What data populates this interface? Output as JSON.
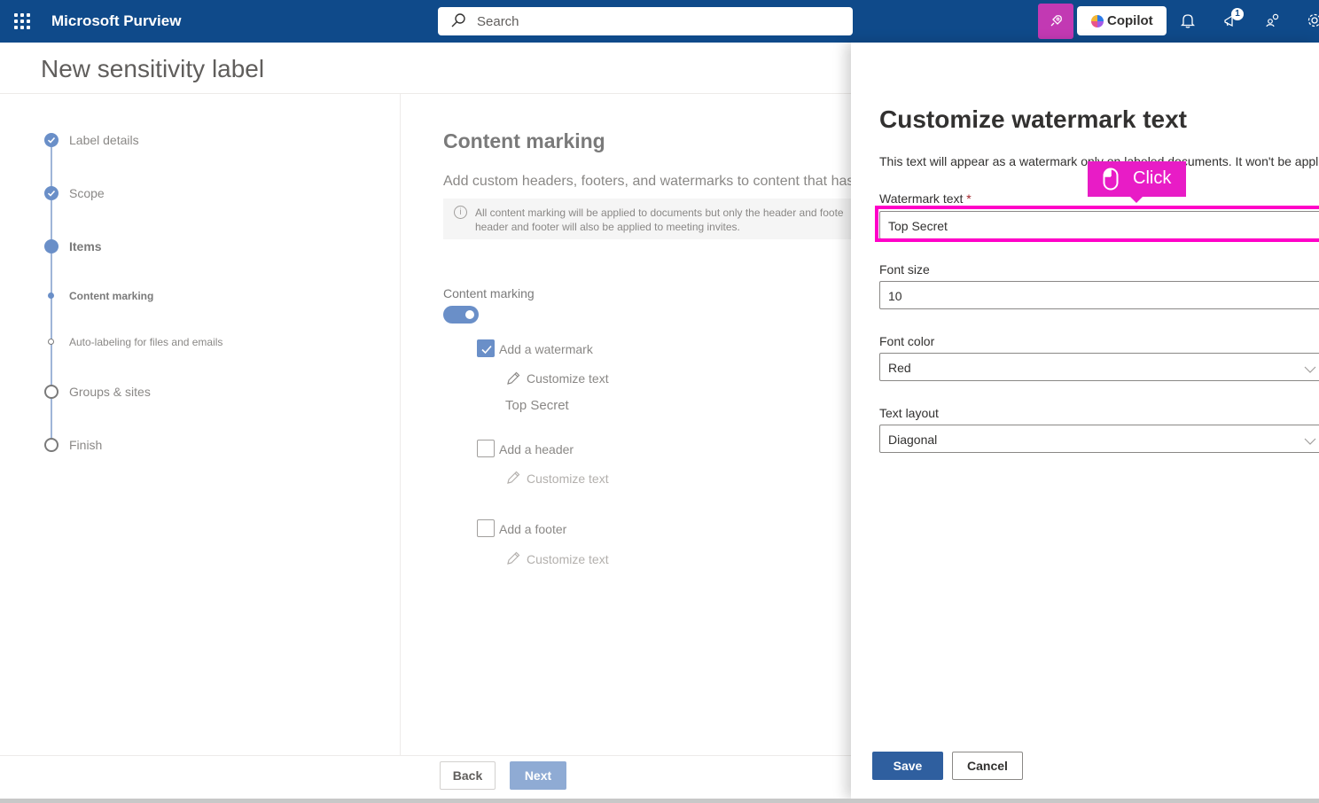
{
  "header": {
    "app_name": "Microsoft Purview",
    "search_placeholder": "Search",
    "copilot_label": "Copilot",
    "notification_count": "1"
  },
  "page": {
    "title": "New sensitivity label"
  },
  "stepper": {
    "steps": [
      {
        "label": "Label details",
        "state": "completed"
      },
      {
        "label": "Scope",
        "state": "completed"
      },
      {
        "label": "Items",
        "state": "current"
      },
      {
        "label": "Content marking",
        "state": "current-substep"
      },
      {
        "label": "Auto-labeling for files and emails",
        "state": "pending-substep"
      },
      {
        "label": "Groups & sites",
        "state": "pending"
      },
      {
        "label": "Finish",
        "state": "pending"
      }
    ]
  },
  "content": {
    "heading": "Content marking",
    "description": "Add custom headers, footers, and watermarks to content that has",
    "info_text": "All content marking will be applied to documents but only the header and foote\nheader and footer will also be applied to meeting invites.",
    "toggle_label": "Content marking",
    "toggle_on": true,
    "watermark": {
      "label": "Add a watermark",
      "checked": true,
      "customize": "Customize text",
      "value": "Top Secret"
    },
    "header_opt": {
      "label": "Add a header",
      "checked": false,
      "customize": "Customize text"
    },
    "footer_opt": {
      "label": "Add a footer",
      "checked": false,
      "customize": "Customize text"
    }
  },
  "footer": {
    "back": "Back",
    "next": "Next"
  },
  "panel": {
    "title": "Customize watermark text",
    "description": "This text will appear as a watermark only on labeled documents. It won't be appli messages.",
    "watermark_label": "Watermark text",
    "required_mark": "*",
    "watermark_value": "Top Secret",
    "font_size_label": "Font size",
    "font_size_value": "10",
    "font_color_label": "Font color",
    "font_color_value": "Red",
    "text_layout_label": "Text layout",
    "text_layout_value": "Diagonal",
    "save": "Save",
    "cancel": "Cancel"
  },
  "annotation": {
    "label": "Click"
  },
  "colors": {
    "topbar": "#0f4a8a",
    "accent": "#6a8fc8",
    "primary_button": "#2f5f9f",
    "highlight": "#ff00c8"
  }
}
